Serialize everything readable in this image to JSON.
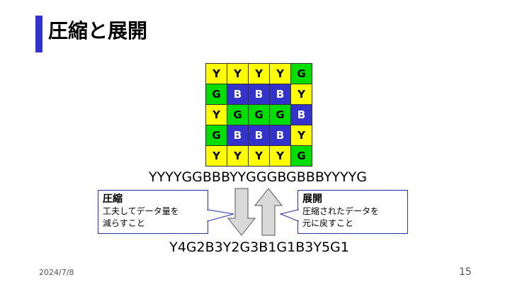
{
  "slide": {
    "title": "圧縮と展開",
    "date": "2024/7/8",
    "page_number": "15"
  },
  "grid": {
    "rows": [
      [
        "Y",
        "Y",
        "Y",
        "Y",
        "G"
      ],
      [
        "G",
        "B",
        "B",
        "B",
        "Y"
      ],
      [
        "Y",
        "G",
        "G",
        "G",
        "B"
      ],
      [
        "G",
        "B",
        "B",
        "B",
        "Y"
      ],
      [
        "Y",
        "Y",
        "Y",
        "Y",
        "G"
      ]
    ],
    "colors": {
      "Y": "#ffff00",
      "G": "#00dd00",
      "B": "#3333cc"
    }
  },
  "sequence": {
    "raw": "YYYYGGBBBYYGGGBGBBBYYYYG",
    "compressed": "Y4G2B3Y2G3B1G1B3Y5G1"
  },
  "callouts": {
    "compress": {
      "title": "圧縮",
      "line1": "工夫してデータ量を",
      "line2": "減らすこと"
    },
    "expand": {
      "title": "展開",
      "line1": "圧縮されたデータを",
      "line2": "元に戻すこと"
    }
  }
}
